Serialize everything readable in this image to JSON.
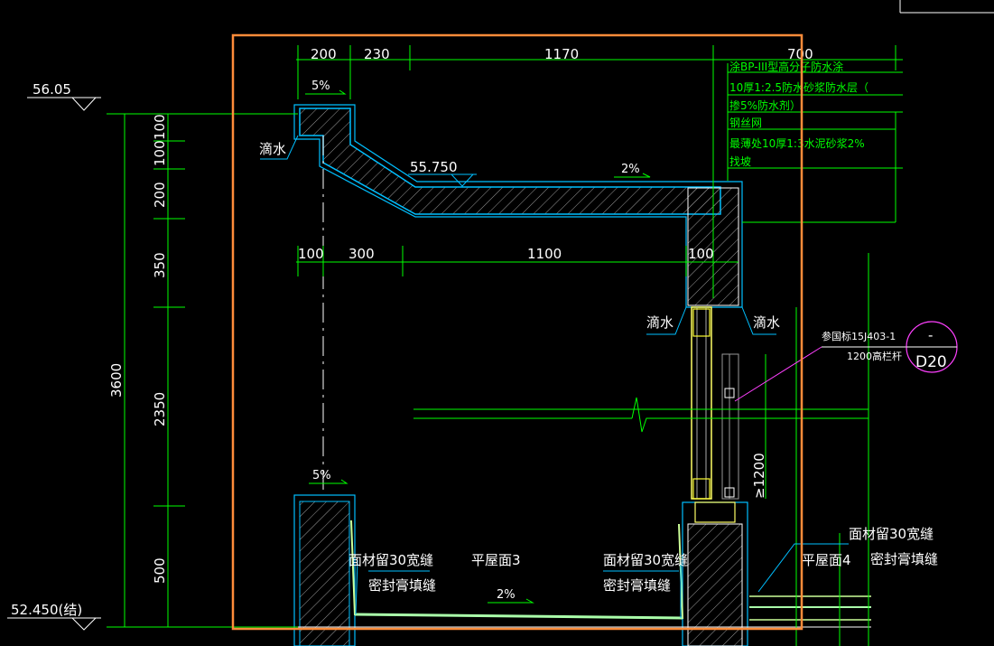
{
  "levels": {
    "top": "56.05",
    "bottom": "52.450(结)",
    "canopy": "55.750"
  },
  "top_dims": [
    "200",
    "230",
    "1170",
    "700"
  ],
  "mid_dims": [
    "100",
    "300",
    "1100",
    "100"
  ],
  "left_dims": [
    "100",
    "100",
    "200",
    "350",
    "2350",
    "500"
  ],
  "total_dim": "3600",
  "railing_dim": "≥1200",
  "slopes": {
    "canopy_top": "5%",
    "canopy_slope": "2%",
    "parapet": "5%",
    "roof": "2%"
  },
  "drip_label": "滴水",
  "callouts": {
    "layers": [
      "涂BP-III型高分子防水涂",
      "10厚1:2.5防水砂浆防水层（",
      "掺5%防水剂）",
      "钢丝网",
      "最薄处10厚1:3水泥砂浆2%",
      "找坡"
    ],
    "joint_a1": "面材留30宽缝",
    "joint_a2": "密封膏填缝",
    "roof3": "平屋面3",
    "joint_b1": "面材留30宽缝",
    "joint_b2": "密封膏填缝",
    "roof4": "平屋面4",
    "joint_c1": "面材留30宽缝",
    "joint_c2": "密封膏填缝"
  },
  "ref": {
    "note1": "参国标15J403-1",
    "note2": "1200高栏杆",
    "top": "-",
    "bottom": "D20"
  },
  "colors": {
    "background": "#000000",
    "highlight": "#ff8c3a",
    "dimension": "#00ff00",
    "section": "#00bfff",
    "text": "#ffffff",
    "reference": "#ff40ff"
  }
}
